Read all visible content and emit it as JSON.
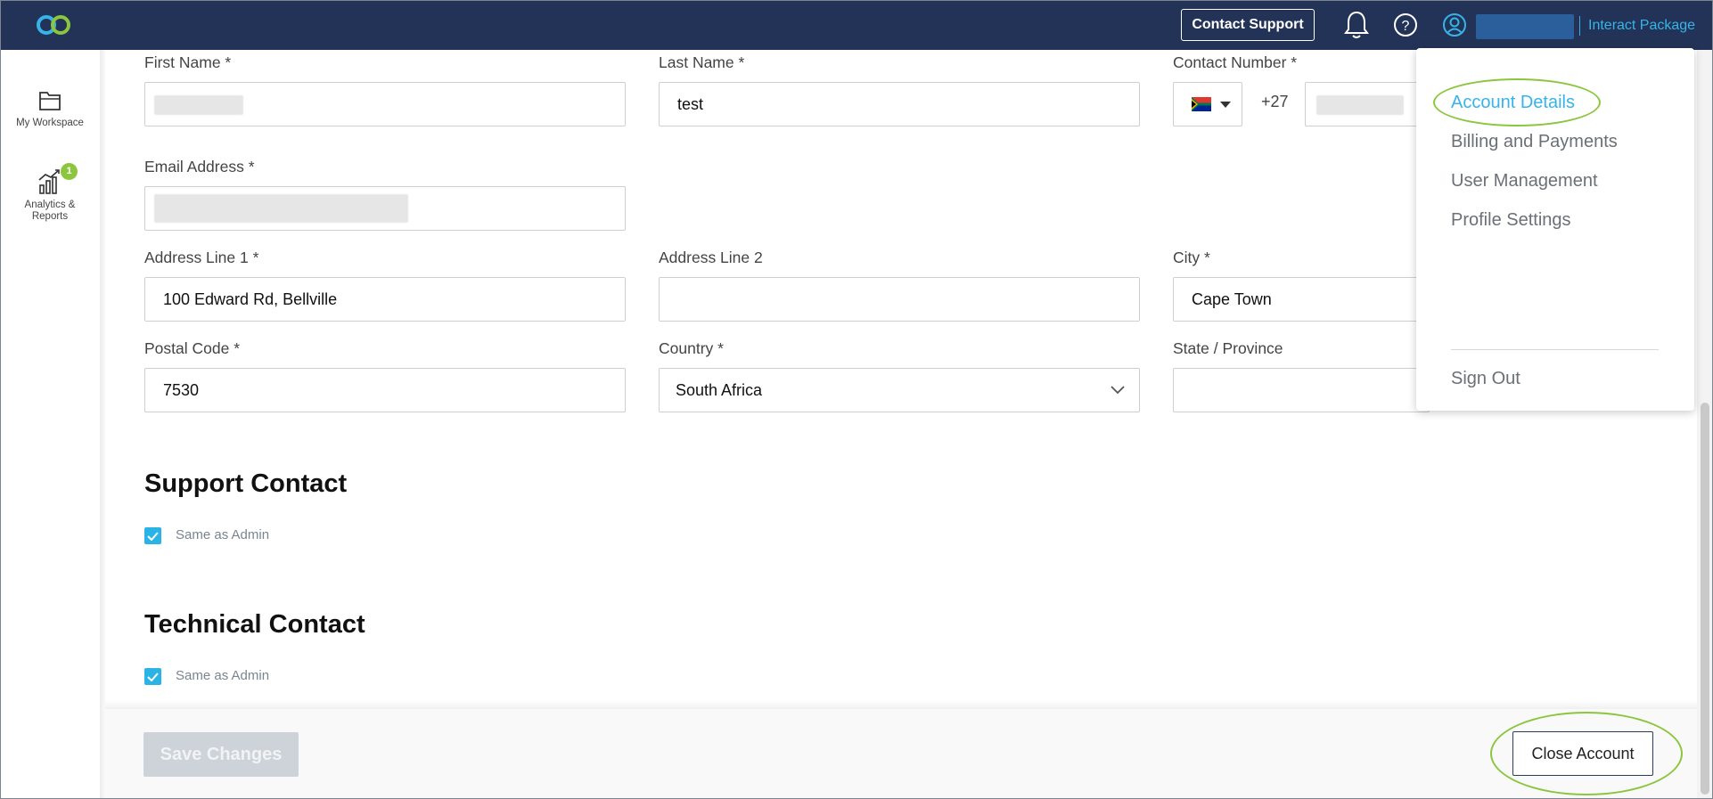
{
  "header": {
    "contact_support": "Contact Support",
    "package_label": "Interact Package",
    "brand_color": "#233357",
    "accent_color": "#36b4ea",
    "highlight_color": "#8cc63f"
  },
  "sidebar": {
    "items": [
      {
        "label": "My Workspace",
        "icon": "folder-icon"
      },
      {
        "label_line1": "Analytics &",
        "label_line2": "Reports",
        "icon": "analytics-icon",
        "badge": "1"
      }
    ]
  },
  "form": {
    "first_name_label": "First Name *",
    "last_name_label": "Last Name *",
    "last_name_value": "test",
    "contact_number_label": "Contact Number *",
    "dial_code": "+27",
    "email_label": "Email Address *",
    "address1_label": "Address Line 1 *",
    "address1_value": "100 Edward Rd, Bellville",
    "address2_label": "Address Line 2",
    "address2_value": "",
    "city_label": "City *",
    "city_value": "Cape Town",
    "postal_label": "Postal Code *",
    "postal_value": "7530",
    "country_label": "Country *",
    "country_value": "South Africa",
    "state_label": "State / Province",
    "state_value": ""
  },
  "support_contact": {
    "title": "Support Contact",
    "same_as_admin": "Same as Admin",
    "checked": true
  },
  "technical_contact": {
    "title": "Technical Contact",
    "same_as_admin": "Same as Admin",
    "checked": true
  },
  "footer": {
    "save_label": "Save Changes",
    "close_label": "Close Account"
  },
  "menu": {
    "items": [
      "Account Details",
      "Billing and Payments",
      "User Management",
      "Profile Settings"
    ],
    "sign_out": "Sign Out"
  }
}
